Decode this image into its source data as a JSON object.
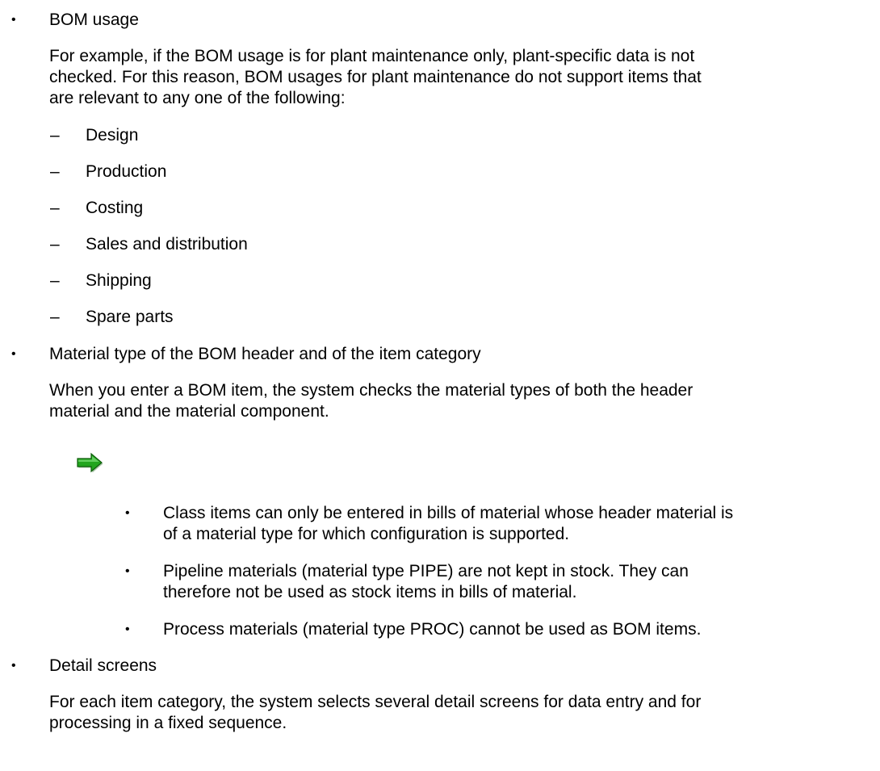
{
  "bullets": {
    "bom_usage": "BOM usage",
    "material_type": "Material type of the BOM header and of the item category",
    "detail_screens": "Detail screens"
  },
  "paragraphs": {
    "bom_usage_line1": "For example, if the BOM usage is for plant maintenance only, plant-specific data is not",
    "bom_usage_line2": "checked. For this reason, BOM usages for plant maintenance do not support items that",
    "bom_usage_line3": "are relevant to any one of the following:",
    "material_type_line1": "When you enter a BOM item, the system checks the material types of both the header",
    "material_type_line2": "material and the material component.",
    "detail_screens_line1": "For each item category, the system selects several detail screens for data entry and for",
    "detail_screens_line2": "processing in a fixed sequence."
  },
  "dash_items": [
    "Design",
    "Production",
    "Costing",
    "Sales and distribution",
    "Shipping",
    "Spare parts"
  ],
  "note_items": {
    "class_items_line1": "Class items can only be entered in bills of material whose header material is",
    "class_items_line2": "of a material type for which configuration is supported.",
    "pipeline_line1": "Pipeline materials (material type PIPE) are not kept in stock. They can",
    "pipeline_line2": "therefore not be used as stock items in bills of material.",
    "process_line1": "Process materials (material type PROC) cannot be used as BOM items."
  },
  "symbols": {
    "bullet": "•",
    "dash": "–"
  },
  "icons": {
    "note_arrow": "right-arrow-icon"
  },
  "colors": {
    "arrow_green": "#22a51e",
    "arrow_dark": "#0d5c0a",
    "text": "#000000"
  }
}
